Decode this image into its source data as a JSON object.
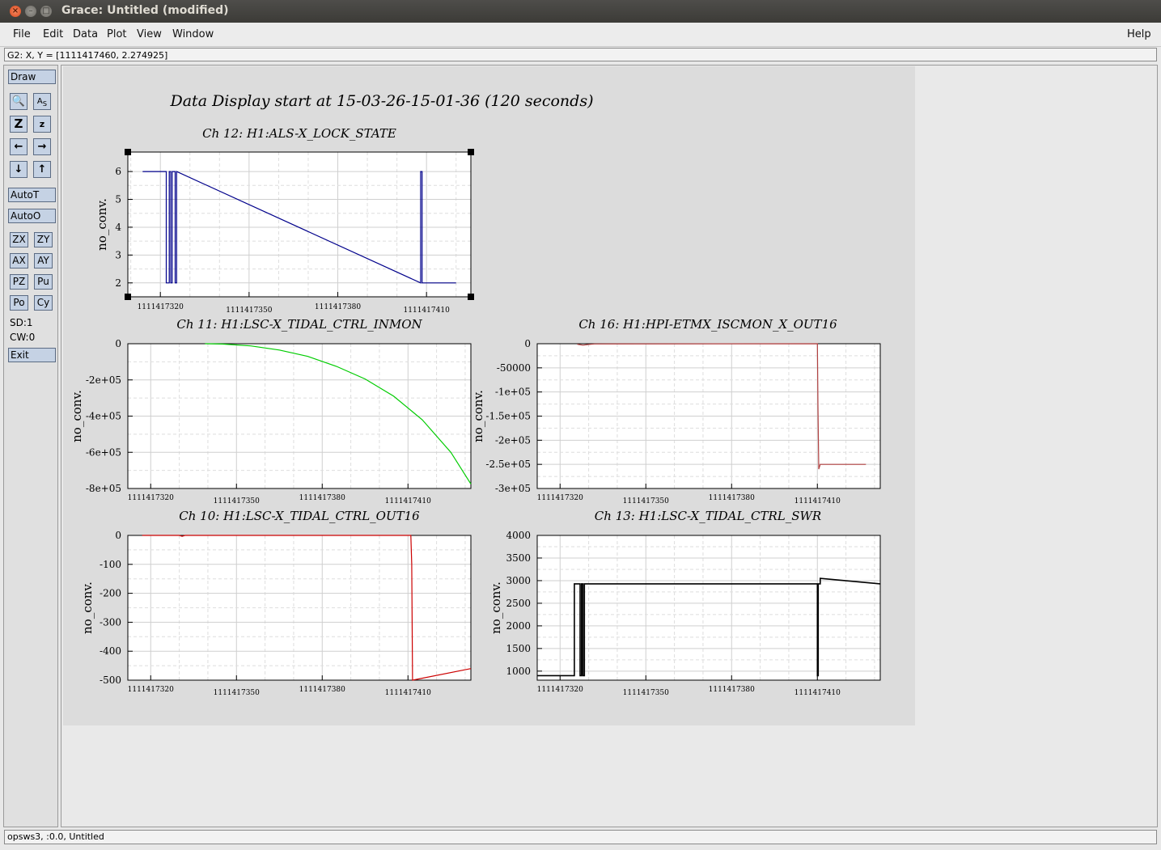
{
  "window": {
    "title": "Grace: Untitled (modified)"
  },
  "menu": {
    "items": [
      "File",
      "Edit",
      "Data",
      "Plot",
      "View",
      "Window"
    ],
    "help": "Help"
  },
  "locator": "G2: X, Y = [1111417460, 2.274925]",
  "toolbar": {
    "draw": "Draw",
    "autot": "AutoT",
    "autoo": "AutoO",
    "zx": "ZX",
    "zy": "ZY",
    "ax": "AX",
    "ay": "AY",
    "pz": "PZ",
    "pu": "Pu",
    "po": "Po",
    "cy": "Cy",
    "sd": "SD:1",
    "cw": "CW:0",
    "exit": "Exit",
    "icons": [
      "zoom-icon",
      "autoscale-text-icon",
      "zoom-in-icon",
      "zoom-out-icon",
      "left-arrow-icon",
      "right-arrow-icon",
      "down-arrow-icon",
      "up-arrow-icon"
    ]
  },
  "status_bar": "opsws3, :0.0, Untitled",
  "page_title": "Data Display start at 15-03-26-15-01-36 (120 seconds)",
  "chart_data": [
    {
      "type": "line",
      "title": "Ch 12: H1:ALS-X_LOCK_STATE",
      "ylabel": "no_conv.",
      "color": "#00008b",
      "xlim": [
        1111417309,
        1111417425
      ],
      "ylim": [
        1.5,
        6.7
      ],
      "yticks": [
        2,
        3,
        4,
        5,
        6
      ],
      "ytick_labels": [
        "2",
        "3",
        "4",
        "5",
        "6"
      ],
      "xticks": [
        1111417320,
        1111417350,
        1111417380,
        1111417410
      ],
      "x": [
        1111417314,
        1111417322,
        1111417322,
        1111417323,
        1111417323,
        1111417323.5,
        1111417323.5,
        1111417324,
        1111417324,
        1111417325,
        1111417325,
        1111417325.5,
        1111417325.5,
        1111417408,
        1111417408,
        1111417408.5,
        1111417408.5,
        1111417420
      ],
      "y": [
        6,
        6,
        2,
        2,
        6,
        6,
        2,
        2,
        6,
        6,
        2,
        2,
        6,
        2,
        6,
        6,
        2,
        2
      ]
    },
    {
      "type": "line",
      "title": "Ch 11: H1:LSC-X_TIDAL_CTRL_INMON",
      "ylabel": "no_conv.",
      "color": "#00cc00",
      "xlim": [
        1111417312,
        1111417432
      ],
      "ylim": [
        -800000,
        0
      ],
      "yticks": [
        0,
        -200000,
        -400000,
        -600000,
        -800000
      ],
      "ytick_labels": [
        "0",
        "-2e+05",
        "-4e+05",
        "-6e+05",
        "-8e+05"
      ],
      "xticks": [
        1111417320,
        1111417350,
        1111417380,
        1111417410
      ],
      "x": [
        1111417339,
        1111417345,
        1111417355,
        1111417365,
        1111417375,
        1111417385,
        1111417395,
        1111417405,
        1111417415,
        1111417425,
        1111417432
      ],
      "y": [
        0,
        -2000,
        -12000,
        -35000,
        -70000,
        -125000,
        -195000,
        -290000,
        -420000,
        -600000,
        -775000
      ]
    },
    {
      "type": "line",
      "title": "Ch 16: H1:HPI-ETMX_ISCMON_X_OUT16",
      "ylabel": "no_conv.",
      "color": "#b04040",
      "xlim": [
        1111417312,
        1111417432
      ],
      "ylim": [
        -300000,
        0
      ],
      "yticks": [
        0,
        -50000,
        -100000,
        -150000,
        -200000,
        -250000,
        -300000
      ],
      "ytick_labels": [
        "0",
        "-50000",
        "-1e+05",
        "-1.5e+05",
        "-2e+05",
        "-2.5e+05",
        "-3e+05"
      ],
      "xticks": [
        1111417320,
        1111417350,
        1111417380,
        1111417410
      ],
      "x": [
        1111417326,
        1111417328,
        1111417330,
        1111417332,
        1111417410,
        1111417410.2,
        1111417410.5,
        1111417411,
        1111417427
      ],
      "y": [
        -1000,
        -3000,
        -1500,
        -500,
        0,
        -130000,
        -260000,
        -250000,
        -250000
      ]
    },
    {
      "type": "line",
      "title": "Ch 10: H1:LSC-X_TIDAL_CTRL_OUT16",
      "ylabel": "no_conv.",
      "color": "#cc0000",
      "xlim": [
        1111417312,
        1111417432
      ],
      "ylim": [
        -500,
        0
      ],
      "yticks": [
        0,
        -100,
        -200,
        -300,
        -400,
        -500
      ],
      "ytick_labels": [
        "0",
        "-100",
        "-200",
        "-300",
        "-400",
        "-500"
      ],
      "xticks": [
        1111417320,
        1111417350,
        1111417380,
        1111417410
      ],
      "x": [
        1111417317,
        1111417330,
        1111417331,
        1111417332,
        1111417411,
        1111417411.3,
        1111417411.6,
        1111417432
      ],
      "y": [
        0,
        0,
        -3,
        0,
        0,
        -100,
        -500,
        -460
      ]
    },
    {
      "type": "line",
      "title": "Ch 13: H1:LSC-X_TIDAL_CTRL_SWR",
      "ylabel": "no_conv.",
      "color": "#000000",
      "xlim": [
        1111417312,
        1111417432
      ],
      "ylim": [
        800,
        4000
      ],
      "yticks": [
        1000,
        1500,
        2000,
        2500,
        3000,
        3500,
        4000
      ],
      "ytick_labels": [
        "1000",
        "1500",
        "2000",
        "2500",
        "3000",
        "3500",
        "4000"
      ],
      "xticks": [
        1111417320,
        1111417350,
        1111417380,
        1111417410
      ],
      "x": [
        1111417312,
        1111417325,
        1111417325,
        1111417327,
        1111417327,
        1111417327.5,
        1111417327.5,
        1111417328,
        1111417328,
        1111417328.5,
        1111417328.5,
        1111417329,
        1111417329,
        1111417410,
        1111417410,
        1111417410.3,
        1111417410.3,
        1111417411,
        1111417411,
        1111417432
      ],
      "y": [
        900,
        900,
        2930,
        2930,
        900,
        900,
        2930,
        2930,
        900,
        900,
        2930,
        2930,
        2930,
        2930,
        900,
        900,
        2930,
        2930,
        3050,
        2930
      ]
    }
  ],
  "tick_label_x": [
    "1111417320",
    "1111417350",
    "1111417380",
    "1111417410"
  ]
}
